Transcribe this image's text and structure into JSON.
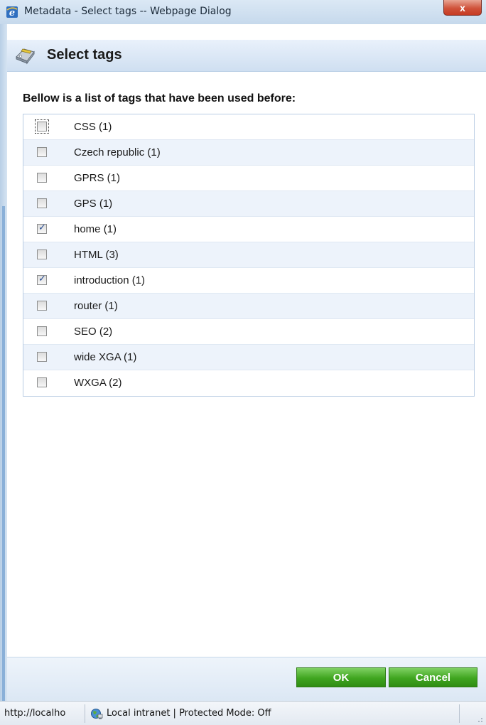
{
  "window": {
    "title": "Metadata - Select tags -- Webpage Dialog",
    "close_label": "x"
  },
  "header": {
    "title": "Select tags",
    "icon": "tag-icon"
  },
  "intro": "Bellow is a list of tags that have been used before:",
  "tags": [
    {
      "label": "CSS (1)",
      "checked": false
    },
    {
      "label": "Czech republic (1)",
      "checked": false
    },
    {
      "label": "GPRS (1)",
      "checked": false
    },
    {
      "label": "GPS (1)",
      "checked": false
    },
    {
      "label": "home (1)",
      "checked": true
    },
    {
      "label": "HTML (3)",
      "checked": false
    },
    {
      "label": "introduction (1)",
      "checked": true
    },
    {
      "label": "router (1)",
      "checked": false
    },
    {
      "label": "SEO (2)",
      "checked": false
    },
    {
      "label": "wide XGA (1)",
      "checked": false
    },
    {
      "label": "WXGA (2)",
      "checked": false
    }
  ],
  "buttons": {
    "ok": "OK",
    "cancel": "Cancel"
  },
  "statusbar": {
    "url": "http://localho",
    "zone": "Local intranet | Protected Mode: Off",
    "zone_icon": "globe-icon"
  },
  "colors": {
    "button_green": "#3fa51f",
    "header_blue": "#cfdff1",
    "alt_row": "#edf3fb",
    "close_red": "#d0533b"
  }
}
